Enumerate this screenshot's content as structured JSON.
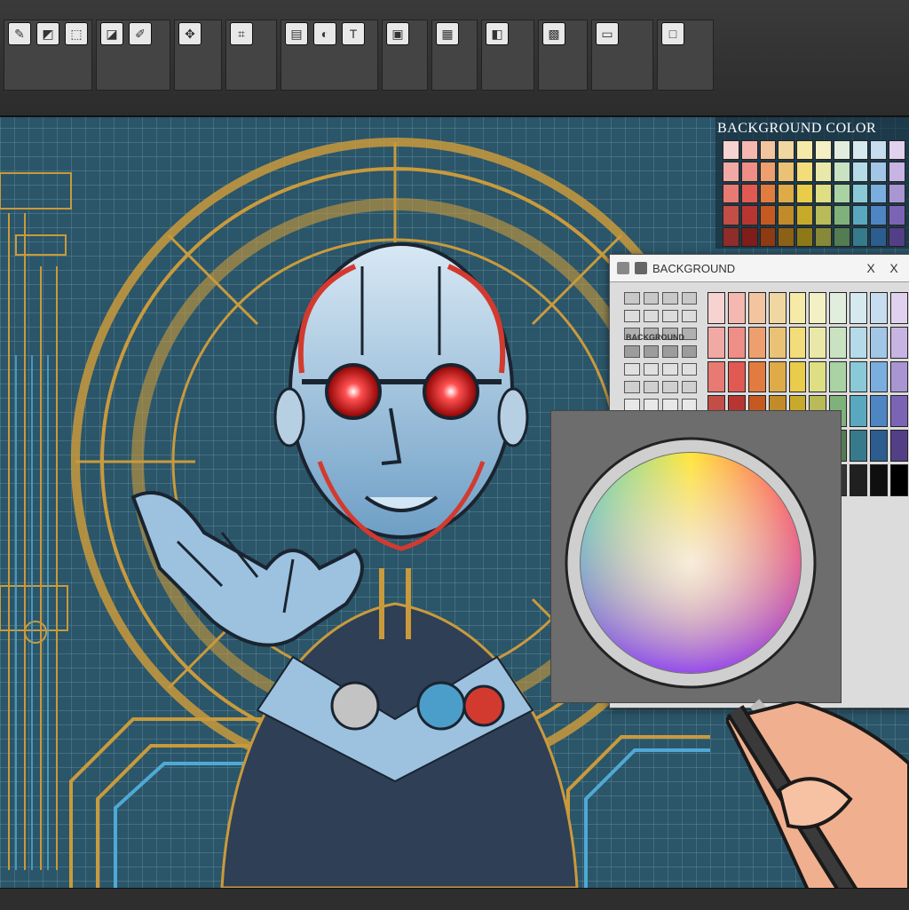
{
  "panel": {
    "title": "BACKGROUND COLOR"
  },
  "dialog": {
    "title": "BACKGROUND",
    "close_1": "X",
    "close_2": "X",
    "label": "BACKGROUND"
  },
  "colors": {
    "canvas_bg": "#2b5568",
    "accent_gold": "#c99a3c",
    "eye_red": "#ff2a2a",
    "face_blue": "#9cc2e0"
  },
  "palette_grid": [
    [
      "#f6d3d0",
      "#f4b8b0",
      "#f3c4a0",
      "#f0d6a0",
      "#f6eaa8",
      "#f2f0c4",
      "#e2eedd",
      "#d6e9ef",
      "#c7dcee",
      "#e0d2ee"
    ],
    [
      "#f1a9a6",
      "#ee8e86",
      "#ee9f6f",
      "#e9c276",
      "#f2dd7a",
      "#e9e8a8",
      "#c8e2c2",
      "#b4dbe7",
      "#a2c6e6",
      "#c8b4e2"
    ],
    [
      "#e87a74",
      "#e05a53",
      "#e27b40",
      "#dfaa48",
      "#e9cc4a",
      "#dede84",
      "#a9d3a2",
      "#8acad8",
      "#7aaede",
      "#a995d2"
    ],
    [
      "#c34d47",
      "#b83631",
      "#c45a22",
      "#c18b2a",
      "#c7aa2c",
      "#b9ba5a",
      "#7fb27a",
      "#5aa8bf",
      "#4e85c2",
      "#7c64b4"
    ],
    [
      "#8e2d29",
      "#7e1d1a",
      "#8e3a12",
      "#8b6118",
      "#8e7818",
      "#878838",
      "#537c52",
      "#367a8c",
      "#2d5c8e",
      "#523f86"
    ],
    [
      "#b9b9b9",
      "#a3a3a3",
      "#8d8d8d",
      "#777777",
      "#616161",
      "#4b4b4b",
      "#353535",
      "#202020",
      "#0f0f0f",
      "#000000"
    ]
  ]
}
